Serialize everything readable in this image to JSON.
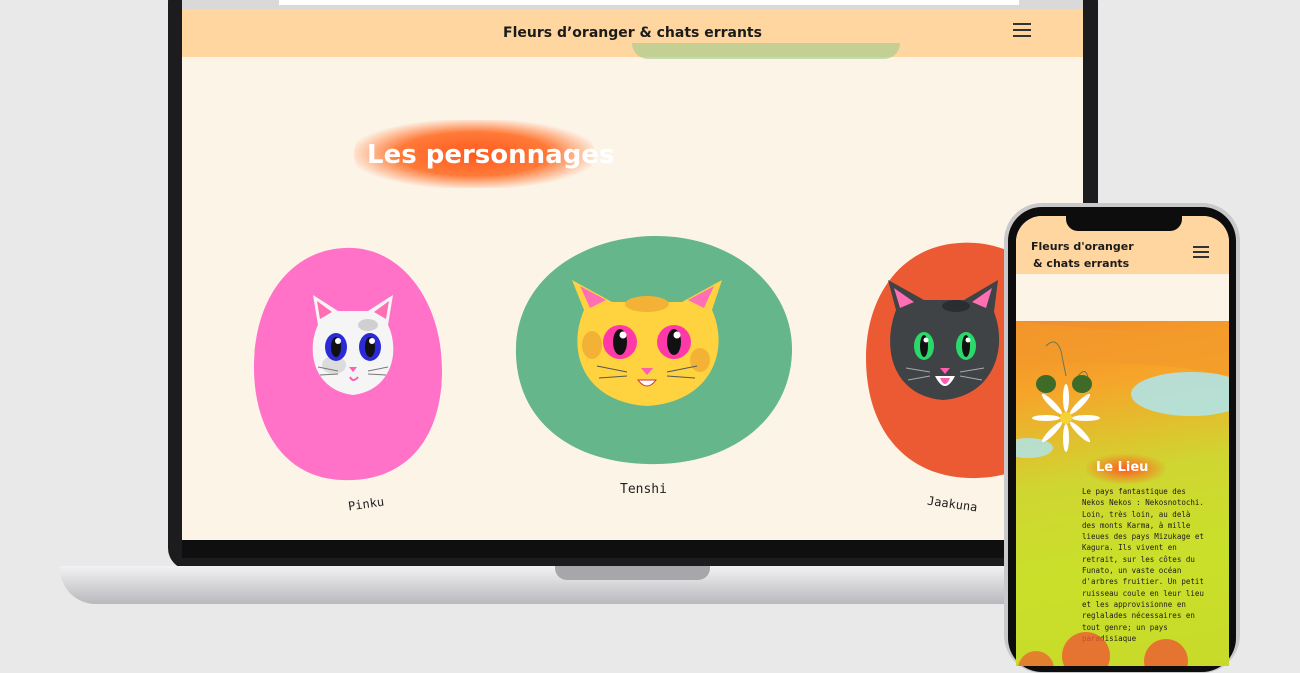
{
  "laptop": {
    "site_title": "Fleurs d’oranger & chats errants",
    "section_title": "Les personnages",
    "characters": [
      {
        "name": "Pinku",
        "blob_color": "#ff72c8"
      },
      {
        "name": "Tenshi",
        "blob_color": "#66b68c"
      },
      {
        "name": "Jaakuna",
        "blob_color": "#ec5a33"
      }
    ]
  },
  "phone": {
    "title_line1": "Fleurs d'oranger",
    "title_line2": "& chats errants",
    "section_title": "Le Lieu",
    "body_text": "Le pays fantastique des Nekos Nekos : Nekosnotochi. Loin, très loin, au delà des monts Karma, à mille lieues des pays Mizukage et Kagura. Ils vivent en retrait, sur les côtes du Funato, un vaste océan d'arbres fruitier. Un petit ruisseau coule en leur lieu et les approvisionne en reglalades nécessaires en tout genre; un pays paradisiaque"
  },
  "colors": {
    "header_bg": "#ffd6a0",
    "page_bg": "#fdf4e8",
    "accent_orange": "#ff5a1f"
  }
}
